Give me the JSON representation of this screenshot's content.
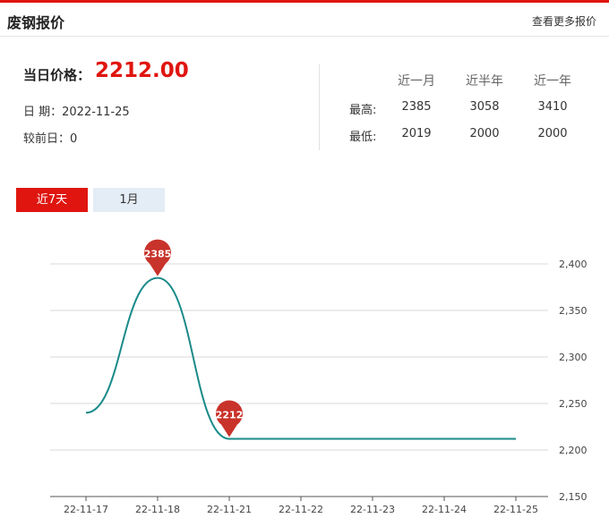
{
  "header": {
    "title": "废钢报价",
    "more_link": "查看更多报价"
  },
  "price": {
    "label": "当日价格：",
    "value": "2212.00",
    "date_text": "日 期：2022-11-25",
    "change_text": "较前日：0"
  },
  "stats": {
    "columns": [
      "近一月",
      "近半年",
      "近一年"
    ],
    "rows": [
      {
        "label": "最高:",
        "values": [
          "2385",
          "3058",
          "3410"
        ]
      },
      {
        "label": "最低:",
        "values": [
          "2019",
          "2000",
          "2000"
        ]
      }
    ]
  },
  "tabs": {
    "items": [
      {
        "label": "近7天",
        "active": true
      },
      {
        "label": "1月",
        "active": false
      }
    ]
  },
  "colors": {
    "accent": "#e0150f",
    "line": "#1a8a8a",
    "marker": "#c8332b",
    "tab_inactive": "#e4ecf6"
  },
  "chart_data": {
    "type": "line",
    "title": "",
    "xlabel": "",
    "ylabel": "",
    "categories": [
      "22-11-17",
      "22-11-18",
      "22-11-21",
      "22-11-22",
      "22-11-23",
      "22-11-24",
      "22-11-25"
    ],
    "series": [
      {
        "values": [
          2240,
          2385,
          2212,
          2212,
          2212,
          2212,
          2212
        ]
      }
    ],
    "ylim": [
      2150,
      2400
    ],
    "yticks": [
      2150,
      2200,
      2250,
      2300,
      2350,
      2400
    ],
    "ytick_labels": [
      "2,150",
      "2,200",
      "2,250",
      "2,300",
      "2,350",
      "2,400"
    ],
    "y_axis_position": "right",
    "grid": true,
    "smooth": true,
    "markers": [
      {
        "index": 1,
        "label": "2385"
      },
      {
        "index": 2,
        "label": "2212"
      }
    ]
  }
}
